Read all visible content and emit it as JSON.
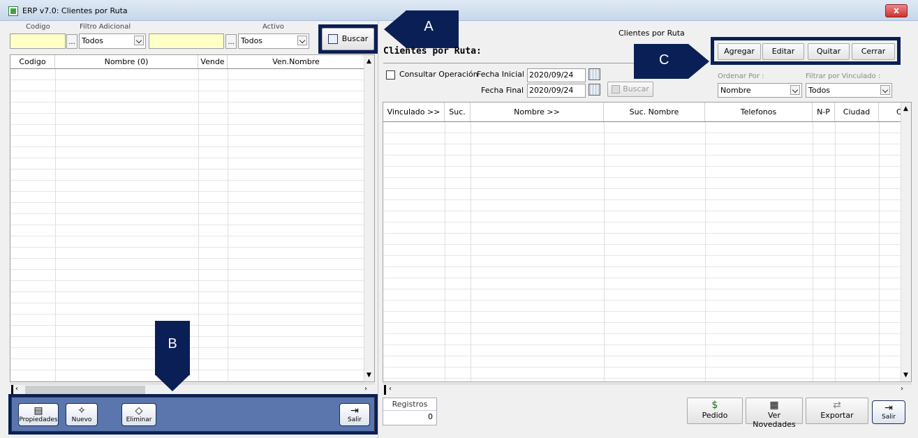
{
  "window": {
    "title": "ERP v7.0: Clientes por Ruta",
    "close": "x"
  },
  "left": {
    "labels": {
      "codigo": "Codigo",
      "filtro": "Filtro Adicional",
      "activo": "Activo"
    },
    "filtro_value": "Todos",
    "activo_value": "Todos",
    "dots": "...",
    "buscar": "Buscar",
    "columns": [
      "Codigo",
      "Nombre (0)",
      "Vende",
      "Ven.Nombre"
    ],
    "buttons": {
      "propiedades": "Propiedades",
      "nuevo": "Nuevo",
      "eliminar": "Eliminar",
      "salir": "Salir"
    }
  },
  "right": {
    "caption": "Clientes por Ruta",
    "heading": "Clientes por Ruta:",
    "consultar": "Consultar Operación",
    "fecha_inicial_label": "Fecha Inicial :",
    "fecha_inicial": "2020/09/24",
    "fecha_final_label": "Fecha Final :",
    "fecha_final": "2020/09/24",
    "buscar": "Buscar",
    "actions": {
      "agregar": "Agregar",
      "editar": "Editar",
      "quitar": "Quitar",
      "cerrar": "Cerrar"
    },
    "ordenar_label": "Ordenar Por :",
    "ordenar_value": "Nombre",
    "filtrar_label": "Filtrar por Vinculado :",
    "filtrar_value": "Todos",
    "columns": [
      "Vinculado >>",
      "Suc.",
      "Nombre >>",
      "Suc. Nombre",
      "Telefonos",
      "N-P",
      "Ciudad",
      "C"
    ],
    "registros_label": "Registros",
    "registros_value": "0",
    "buttons": {
      "pedido": "Pedido",
      "ver_novedades": "Ver Novedades",
      "exportar": "Exportar",
      "salir": "Salir"
    }
  },
  "callouts": {
    "a": "A",
    "b": "B",
    "c": "C"
  }
}
